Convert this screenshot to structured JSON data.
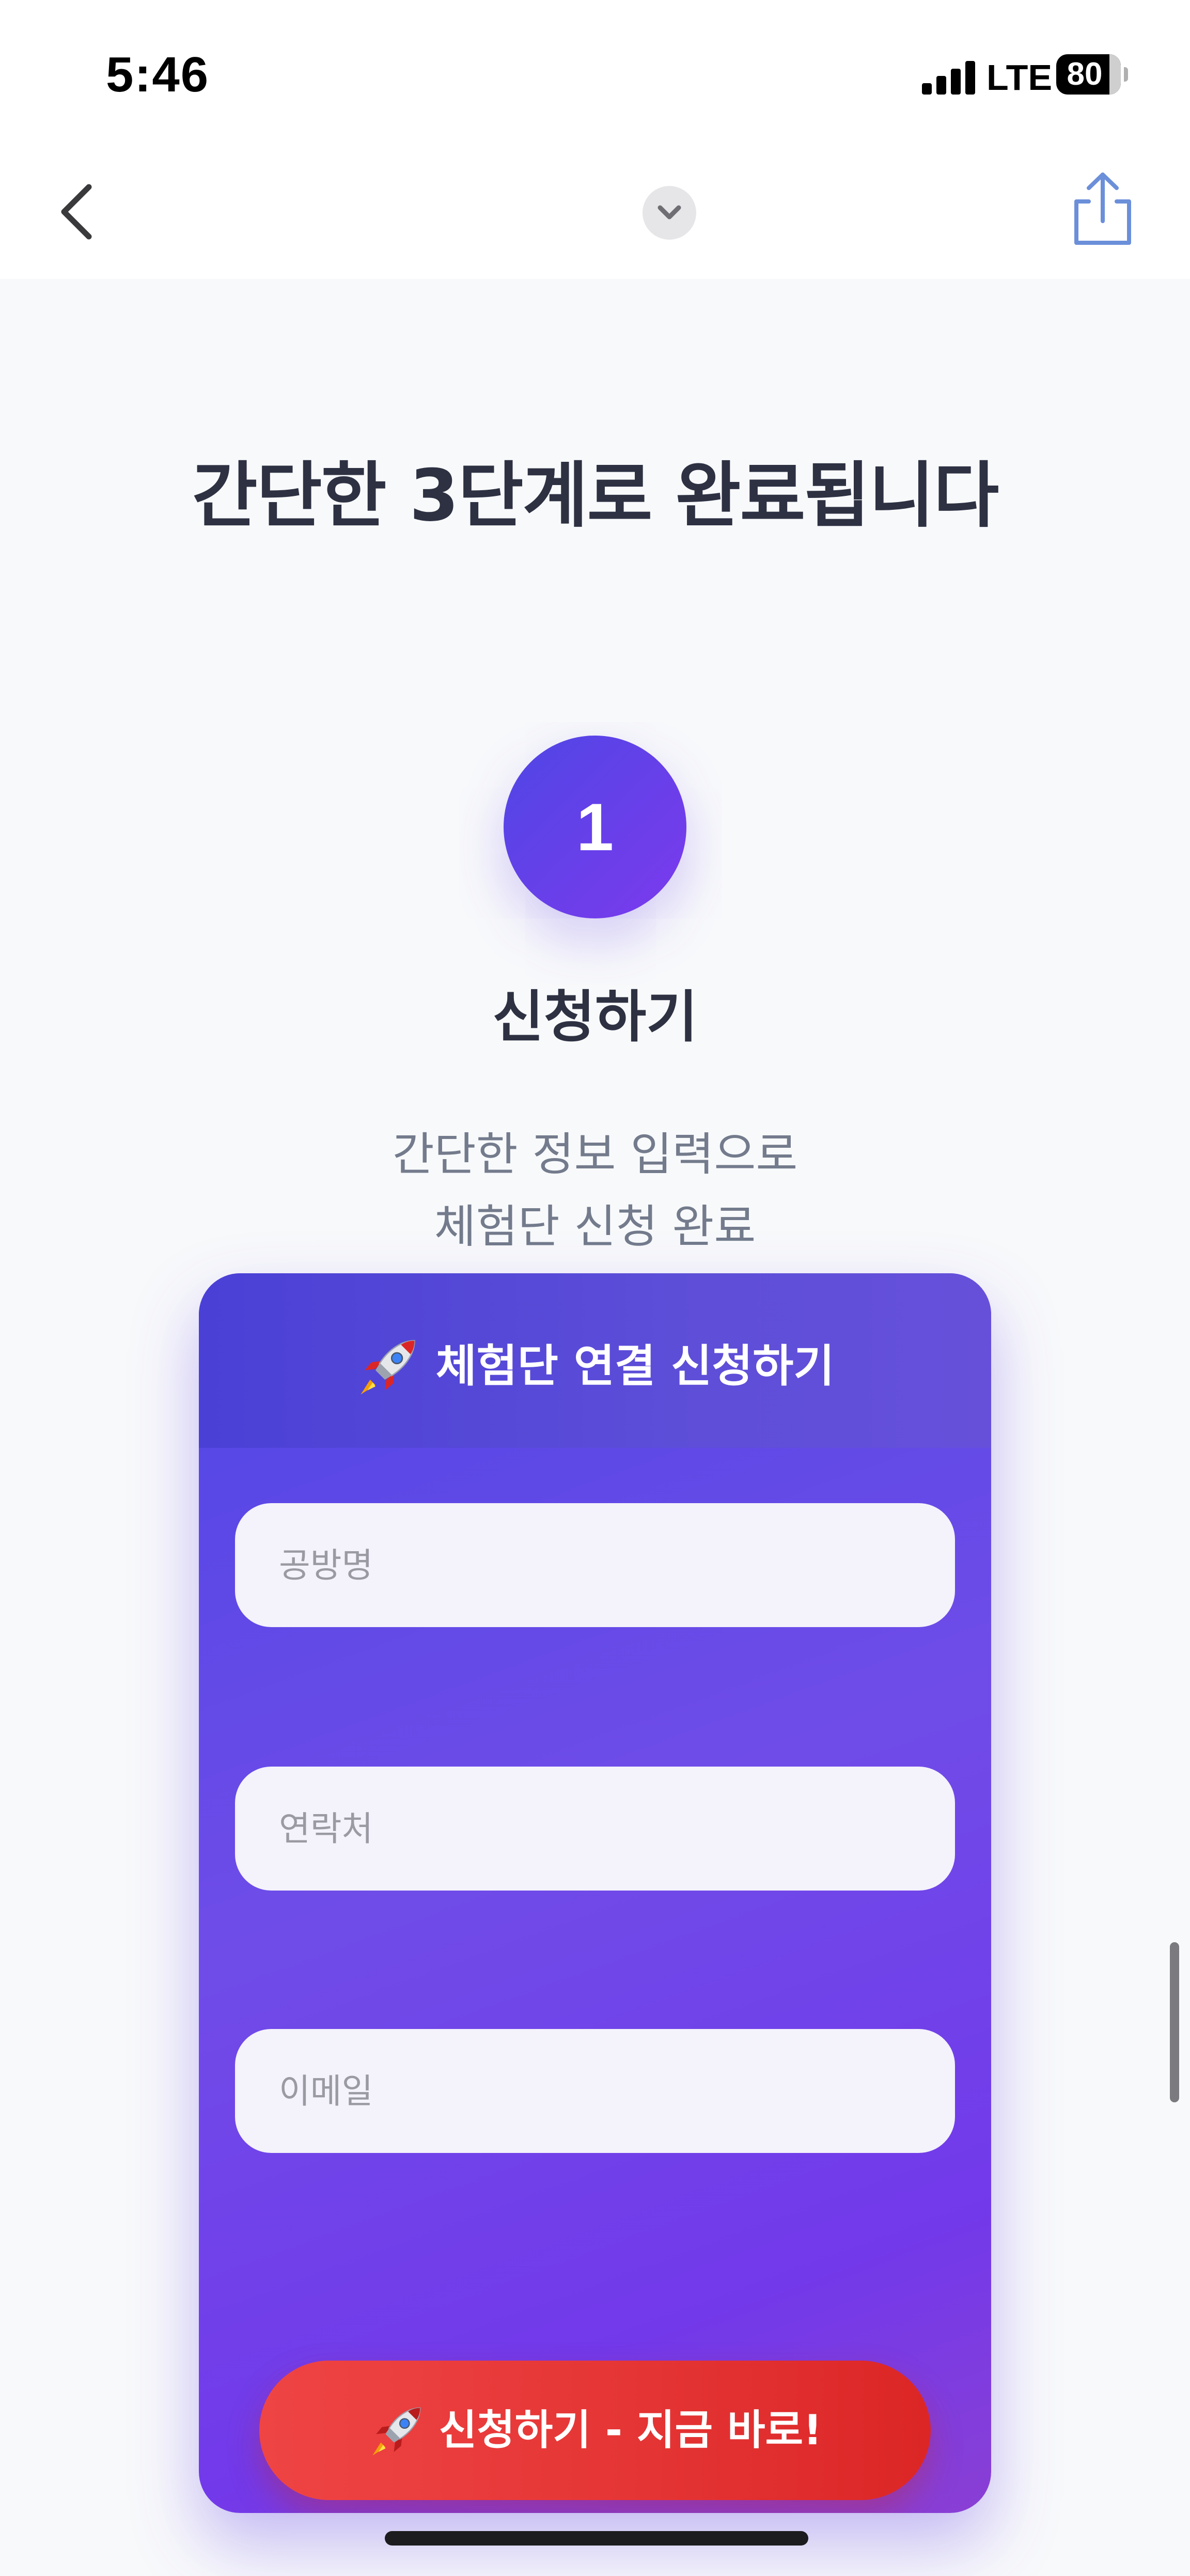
{
  "status_bar": {
    "time": "5:46",
    "network": "LTE",
    "battery_level": "80"
  },
  "nav": {
    "back_icon": "chevron-left-icon",
    "collapse_icon": "chevron-down-icon",
    "share_icon": "share-icon"
  },
  "section": {
    "title": "간단한 3단계로 완료됩니다"
  },
  "step": {
    "number": "1",
    "title": "신청하기",
    "description_lines": [
      "간단한 정보 입력으로",
      "체험단 신청 완료"
    ]
  },
  "form": {
    "header_icon": "rocket-icon",
    "header_title": "체험단 연결 신청하기",
    "fields": [
      {
        "placeholder": "공방명",
        "value": ""
      },
      {
        "placeholder": "연락처",
        "value": ""
      },
      {
        "placeholder": "이메일",
        "value": ""
      }
    ],
    "submit_icon": "rocket-icon",
    "submit_label": "신청하기 - 지금 바로!"
  },
  "colors": {
    "accent_start": "#4f46e5",
    "accent_end": "#7c3aed",
    "submit": "#ef4444",
    "text_dark": "#2d3142",
    "text_muted": "#737b8c"
  }
}
